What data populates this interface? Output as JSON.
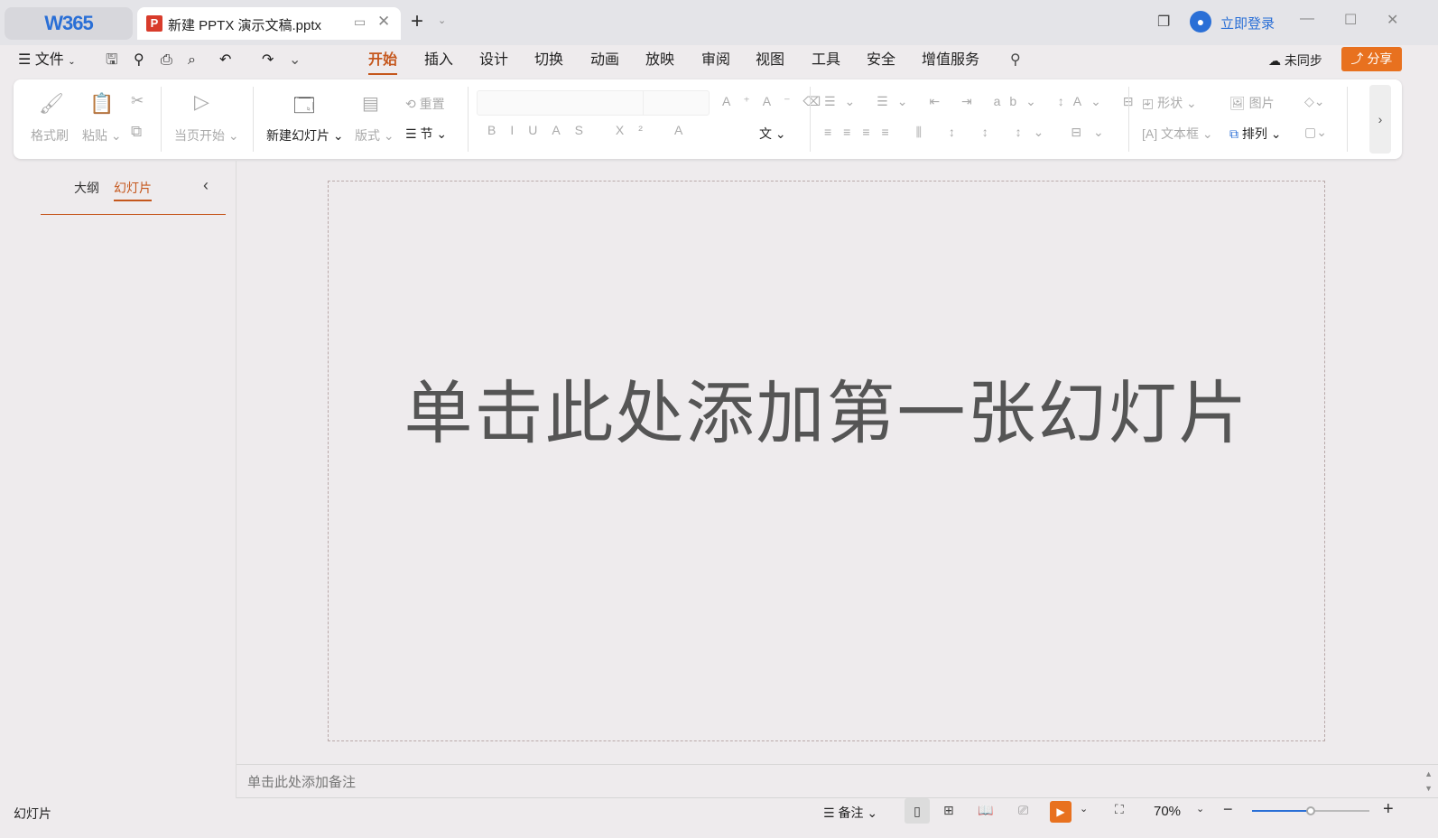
{
  "app": {
    "logo": "W365",
    "tab_title": "新建 PPTX 演示文稿.pptx",
    "login": "立即登录"
  },
  "menu": {
    "file": "文件",
    "tabs": [
      "开始",
      "插入",
      "设计",
      "切换",
      "动画",
      "放映",
      "审阅",
      "视图",
      "工具",
      "安全",
      "增值服务"
    ],
    "active": "开始",
    "sync": "未同步",
    "share": "分享"
  },
  "ribbon": {
    "format_painter": "格式刷",
    "paste": "粘贴",
    "play_current": "当页开始",
    "new_slide": "新建幻灯片",
    "layout": "版式",
    "reset": "重置",
    "section": "节",
    "shape": "形状",
    "picture": "图片",
    "textbox": "文本框",
    "arrange": "排列"
  },
  "left_panel": {
    "tabs": [
      "大纲",
      "幻灯片"
    ],
    "active": "幻灯片"
  },
  "slide": {
    "placeholder": "单击此处添加第一张幻灯片"
  },
  "notes": {
    "placeholder": "单击此处添加备注"
  },
  "status": {
    "label": "幻灯片",
    "notes": "备注",
    "zoom": "70%",
    "zoom_fraction": 0.5
  },
  "colors": {
    "accent": "#c5571d",
    "share": "#e8711f",
    "blue": "#2a6fd6"
  }
}
